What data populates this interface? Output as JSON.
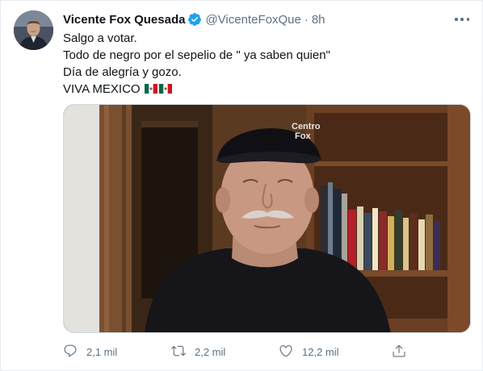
{
  "tweet": {
    "author_name": "Vicente Fox Quesada",
    "handle": "@VicenteFoxQue",
    "separator": "·",
    "time": "8h",
    "verified": true,
    "lines": [
      "Salgo a votar.",
      "Todo de negro por el sepelio de \" ya saben quien\"",
      "Día de alegría y gozo.",
      "VIVA MEXICO"
    ],
    "flag_icons": [
      "mexico-flag-icon",
      "mexico-flag-icon"
    ],
    "hat_text": [
      "Centro",
      "Fox"
    ]
  },
  "actions": {
    "reply_count": "2,1 mil",
    "retweet_count": "2,2 mil",
    "like_count": "12,2 mil"
  },
  "colors": {
    "accent": "#1da1f2",
    "secondary_text": "#5b7083",
    "border": "#e6ecf0"
  }
}
